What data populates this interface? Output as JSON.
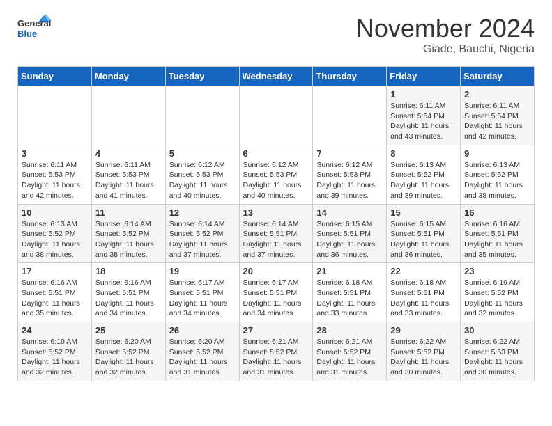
{
  "header": {
    "logo_line1": "General",
    "logo_line2": "Blue",
    "month": "November 2024",
    "location": "Giade, Bauchi, Nigeria"
  },
  "weekdays": [
    "Sunday",
    "Monday",
    "Tuesday",
    "Wednesday",
    "Thursday",
    "Friday",
    "Saturday"
  ],
  "weeks": [
    [
      {
        "day": "",
        "info": ""
      },
      {
        "day": "",
        "info": ""
      },
      {
        "day": "",
        "info": ""
      },
      {
        "day": "",
        "info": ""
      },
      {
        "day": "",
        "info": ""
      },
      {
        "day": "1",
        "info": "Sunrise: 6:11 AM\nSunset: 5:54 PM\nDaylight: 11 hours\nand 43 minutes."
      },
      {
        "day": "2",
        "info": "Sunrise: 6:11 AM\nSunset: 5:54 PM\nDaylight: 11 hours\nand 42 minutes."
      }
    ],
    [
      {
        "day": "3",
        "info": "Sunrise: 6:11 AM\nSunset: 5:53 PM\nDaylight: 11 hours\nand 42 minutes."
      },
      {
        "day": "4",
        "info": "Sunrise: 6:11 AM\nSunset: 5:53 PM\nDaylight: 11 hours\nand 41 minutes."
      },
      {
        "day": "5",
        "info": "Sunrise: 6:12 AM\nSunset: 5:53 PM\nDaylight: 11 hours\nand 40 minutes."
      },
      {
        "day": "6",
        "info": "Sunrise: 6:12 AM\nSunset: 5:53 PM\nDaylight: 11 hours\nand 40 minutes."
      },
      {
        "day": "7",
        "info": "Sunrise: 6:12 AM\nSunset: 5:53 PM\nDaylight: 11 hours\nand 39 minutes."
      },
      {
        "day": "8",
        "info": "Sunrise: 6:13 AM\nSunset: 5:52 PM\nDaylight: 11 hours\nand 39 minutes."
      },
      {
        "day": "9",
        "info": "Sunrise: 6:13 AM\nSunset: 5:52 PM\nDaylight: 11 hours\nand 38 minutes."
      }
    ],
    [
      {
        "day": "10",
        "info": "Sunrise: 6:13 AM\nSunset: 5:52 PM\nDaylight: 11 hours\nand 38 minutes."
      },
      {
        "day": "11",
        "info": "Sunrise: 6:14 AM\nSunset: 5:52 PM\nDaylight: 11 hours\nand 38 minutes."
      },
      {
        "day": "12",
        "info": "Sunrise: 6:14 AM\nSunset: 5:52 PM\nDaylight: 11 hours\nand 37 minutes."
      },
      {
        "day": "13",
        "info": "Sunrise: 6:14 AM\nSunset: 5:51 PM\nDaylight: 11 hours\nand 37 minutes."
      },
      {
        "day": "14",
        "info": "Sunrise: 6:15 AM\nSunset: 5:51 PM\nDaylight: 11 hours\nand 36 minutes."
      },
      {
        "day": "15",
        "info": "Sunrise: 6:15 AM\nSunset: 5:51 PM\nDaylight: 11 hours\nand 36 minutes."
      },
      {
        "day": "16",
        "info": "Sunrise: 6:16 AM\nSunset: 5:51 PM\nDaylight: 11 hours\nand 35 minutes."
      }
    ],
    [
      {
        "day": "17",
        "info": "Sunrise: 6:16 AM\nSunset: 5:51 PM\nDaylight: 11 hours\nand 35 minutes."
      },
      {
        "day": "18",
        "info": "Sunrise: 6:16 AM\nSunset: 5:51 PM\nDaylight: 11 hours\nand 34 minutes."
      },
      {
        "day": "19",
        "info": "Sunrise: 6:17 AM\nSunset: 5:51 PM\nDaylight: 11 hours\nand 34 minutes."
      },
      {
        "day": "20",
        "info": "Sunrise: 6:17 AM\nSunset: 5:51 PM\nDaylight: 11 hours\nand 34 minutes."
      },
      {
        "day": "21",
        "info": "Sunrise: 6:18 AM\nSunset: 5:51 PM\nDaylight: 11 hours\nand 33 minutes."
      },
      {
        "day": "22",
        "info": "Sunrise: 6:18 AM\nSunset: 5:51 PM\nDaylight: 11 hours\nand 33 minutes."
      },
      {
        "day": "23",
        "info": "Sunrise: 6:19 AM\nSunset: 5:52 PM\nDaylight: 11 hours\nand 32 minutes."
      }
    ],
    [
      {
        "day": "24",
        "info": "Sunrise: 6:19 AM\nSunset: 5:52 PM\nDaylight: 11 hours\nand 32 minutes."
      },
      {
        "day": "25",
        "info": "Sunrise: 6:20 AM\nSunset: 5:52 PM\nDaylight: 11 hours\nand 32 minutes."
      },
      {
        "day": "26",
        "info": "Sunrise: 6:20 AM\nSunset: 5:52 PM\nDaylight: 11 hours\nand 31 minutes."
      },
      {
        "day": "27",
        "info": "Sunrise: 6:21 AM\nSunset: 5:52 PM\nDaylight: 11 hours\nand 31 minutes."
      },
      {
        "day": "28",
        "info": "Sunrise: 6:21 AM\nSunset: 5:52 PM\nDaylight: 11 hours\nand 31 minutes."
      },
      {
        "day": "29",
        "info": "Sunrise: 6:22 AM\nSunset: 5:52 PM\nDaylight: 11 hours\nand 30 minutes."
      },
      {
        "day": "30",
        "info": "Sunrise: 6:22 AM\nSunset: 5:53 PM\nDaylight: 11 hours\nand 30 minutes."
      }
    ]
  ]
}
